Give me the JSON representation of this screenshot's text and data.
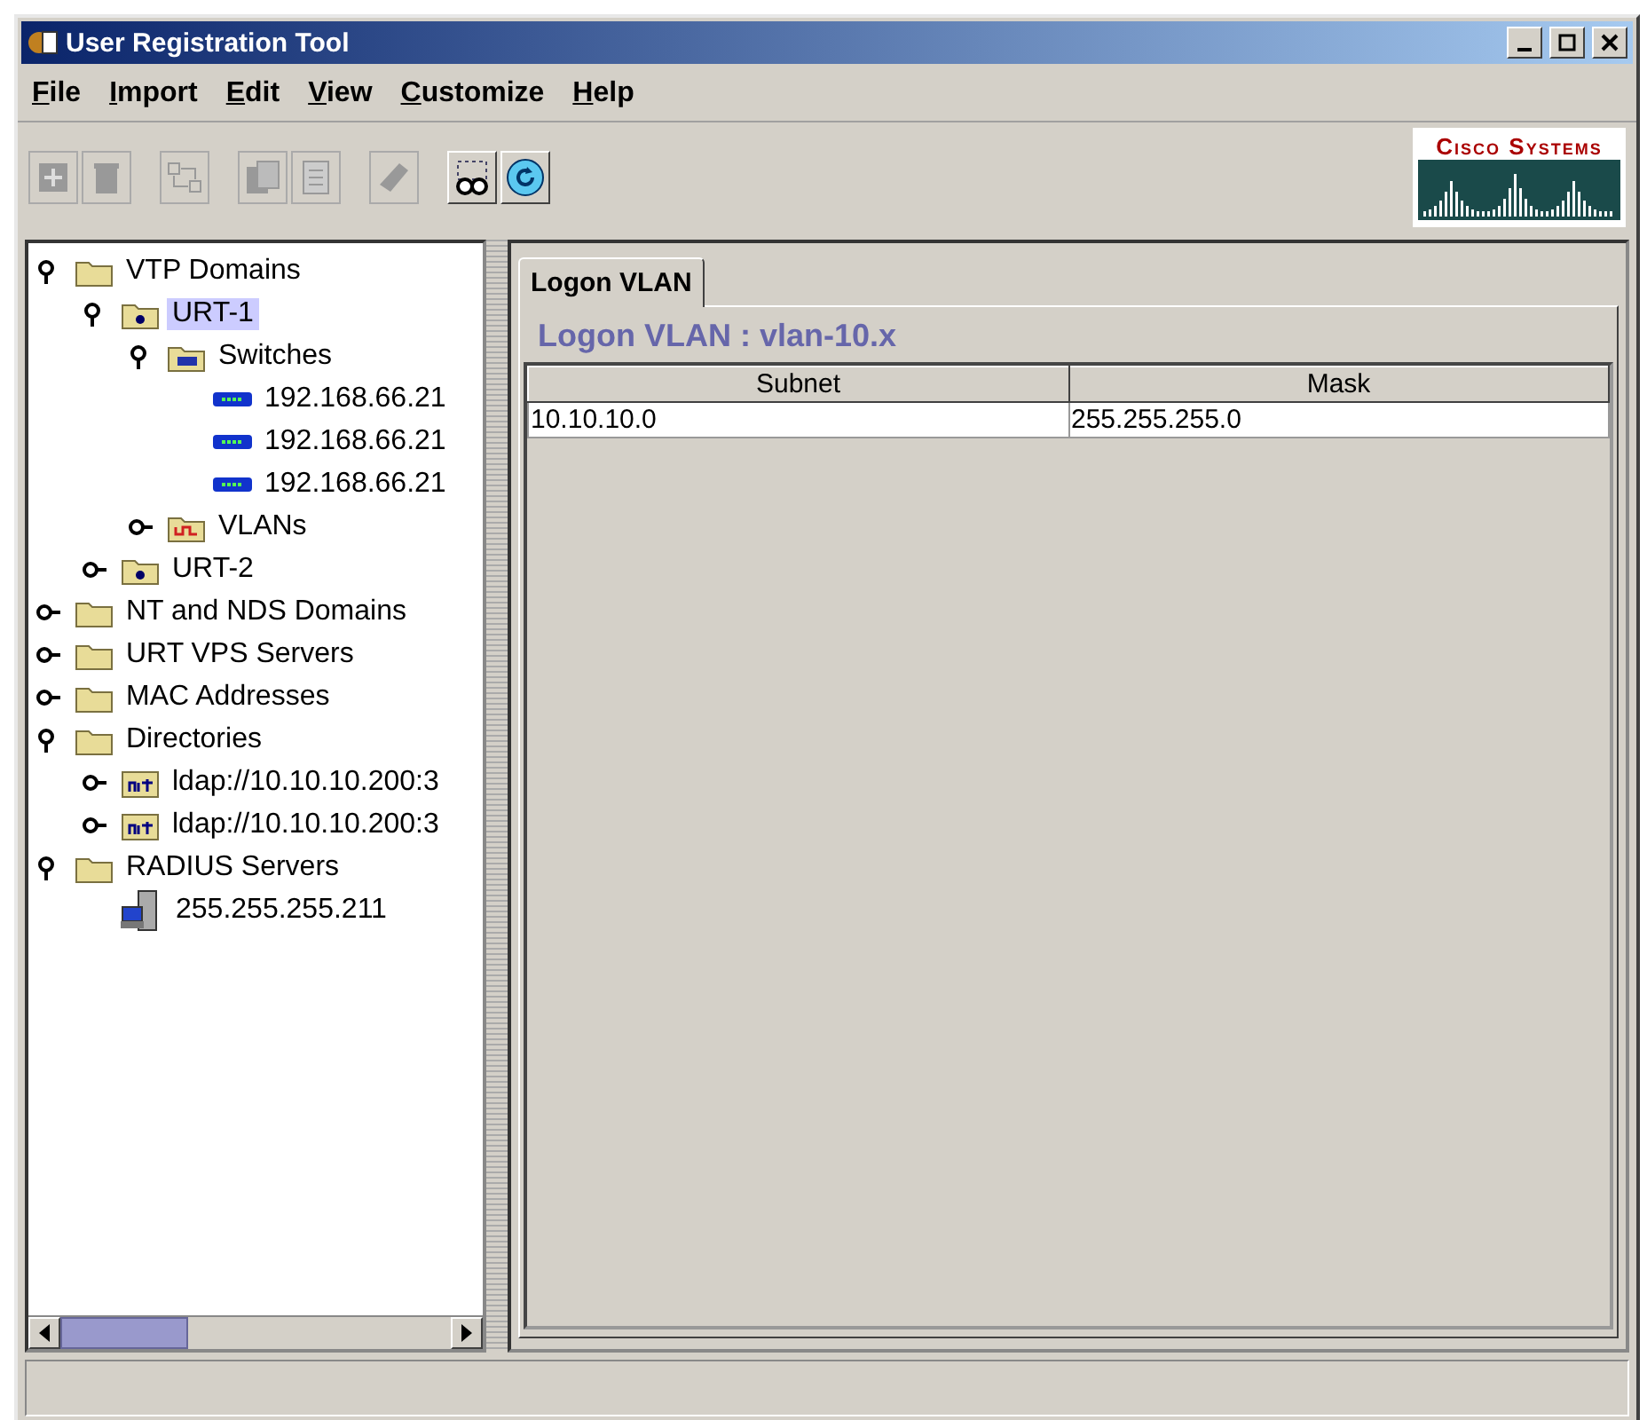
{
  "window": {
    "title": "User Registration Tool"
  },
  "menu": [
    "File",
    "Import",
    "Edit",
    "View",
    "Customize",
    "Help"
  ],
  "toolbar": [
    {
      "kind": "add",
      "disabled": true
    },
    {
      "kind": "delete",
      "disabled": true
    },
    {
      "kind": "move",
      "disabled": true
    },
    {
      "kind": "copy",
      "disabled": true
    },
    {
      "kind": "paste",
      "disabled": true
    },
    {
      "kind": "edit",
      "disabled": true
    },
    {
      "kind": "find",
      "disabled": false
    },
    {
      "kind": "refresh",
      "disabled": false
    }
  ],
  "logo": {
    "text": "Cisco Systems"
  },
  "tree": [
    {
      "label": "VTP Domains",
      "kind": "folder",
      "expanded": true,
      "selected": false,
      "children": [
        {
          "label": "URT-1",
          "kind": "domain",
          "expanded": true,
          "selected": true,
          "children": [
            {
              "label": "Switches",
              "kind": "switches",
              "expanded": true,
              "selected": false,
              "children": [
                {
                  "label": "192.168.66.21",
                  "kind": "switch",
                  "selected": false
                },
                {
                  "label": "192.168.66.21",
                  "kind": "switch",
                  "selected": false
                },
                {
                  "label": "192.168.66.21",
                  "kind": "switch",
                  "selected": false
                }
              ]
            },
            {
              "label": "VLANs",
              "kind": "vlans",
              "expanded": false,
              "selected": false
            }
          ]
        },
        {
          "label": "URT-2",
          "kind": "domain",
          "expanded": false,
          "selected": false
        }
      ]
    },
    {
      "label": "NT and NDS Domains",
      "kind": "folder",
      "expanded": false,
      "selected": false
    },
    {
      "label": "URT VPS Servers",
      "kind": "folder",
      "expanded": false,
      "selected": false
    },
    {
      "label": "MAC Addresses",
      "kind": "folder",
      "expanded": false,
      "selected": false
    },
    {
      "label": "Directories",
      "kind": "folder",
      "expanded": true,
      "selected": false,
      "children": [
        {
          "label": "ldap://10.10.10.200:3",
          "kind": "directory",
          "expanded": false,
          "selected": false
        },
        {
          "label": "ldap://10.10.10.200:3",
          "kind": "directory",
          "expanded": false,
          "selected": false
        }
      ]
    },
    {
      "label": "RADIUS Servers",
      "kind": "folder",
      "expanded": true,
      "selected": false,
      "children": [
        {
          "label": "255.255.255.211",
          "kind": "server",
          "selected": false
        }
      ]
    }
  ],
  "tabs": [
    {
      "label": "Logon VLAN",
      "selected": true
    }
  ],
  "panel": {
    "heading": "Logon VLAN : vlan-10.x",
    "table": {
      "columns": [
        "Subnet",
        "Mask"
      ],
      "rows": [
        [
          "10.10.10.0",
          "255.255.255.0"
        ]
      ]
    }
  }
}
